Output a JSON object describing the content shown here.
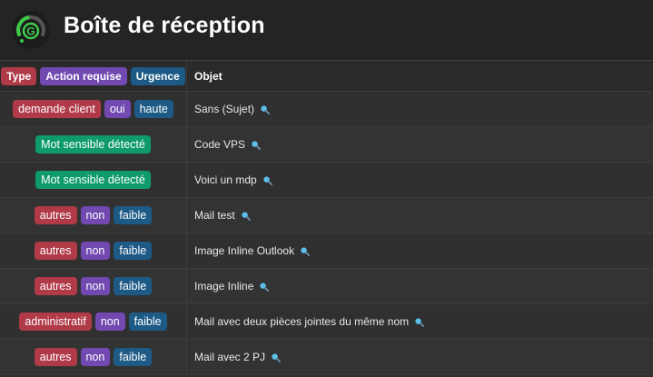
{
  "header": {
    "title": "Boîte de réception",
    "logo_icon": "gauge-logo-icon"
  },
  "table": {
    "headers": {
      "type": "Type",
      "action": "Action requise",
      "urgence": "Urgence",
      "objet": "Objet"
    },
    "rows": [
      {
        "type": "demande client",
        "action": "oui",
        "urgence": "haute",
        "sensible": "",
        "objet": "Sans (Sujet)"
      },
      {
        "type": "",
        "action": "",
        "urgence": "",
        "sensible": "Mot sensible détecté",
        "objet": "Code VPS"
      },
      {
        "type": "",
        "action": "",
        "urgence": "",
        "sensible": "Mot sensible détecté",
        "objet": "Voici un mdp"
      },
      {
        "type": "autres",
        "action": "non",
        "urgence": "faible",
        "sensible": "",
        "objet": "Mail test"
      },
      {
        "type": "autres",
        "action": "non",
        "urgence": "faible",
        "sensible": "",
        "objet": "Image Inline Outlook"
      },
      {
        "type": "autres",
        "action": "non",
        "urgence": "faible",
        "sensible": "",
        "objet": "Image Inline"
      },
      {
        "type": "administratif",
        "action": "non",
        "urgence": "faible",
        "sensible": "",
        "objet": "Mail avec deux pièces jointes du même nom"
      },
      {
        "type": "autres",
        "action": "non",
        "urgence": "faible",
        "sensible": "",
        "objet": "Mail avec 2 PJ"
      }
    ]
  },
  "colors": {
    "type": "#b03a48",
    "action": "#7149b0",
    "urgence": "#1d5a86",
    "sensible": "#0e9a6b",
    "magnifier": "#5bc0eb"
  }
}
